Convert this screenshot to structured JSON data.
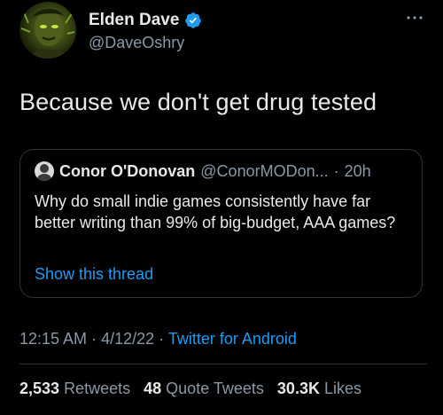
{
  "author": {
    "display_name": "Elden Dave",
    "handle": "@DaveOshry",
    "verified_color": "#1d9bf0"
  },
  "more_icon": "more-icon",
  "tweet_text": "Because we don't get drug tested",
  "quote": {
    "name": "Conor O'Donovan",
    "handle": "@ConorMODon...",
    "separator": "·",
    "time": "20h",
    "text": "Why do small indie games consistently have far better writing than 99% of big-budget, AAA games?",
    "show_thread": "Show this thread"
  },
  "meta": {
    "time": "12:15 AM",
    "dot1": "·",
    "date": "4/12/22",
    "dot2": "·",
    "source": "Twitter for Android"
  },
  "stats": {
    "retweets_count": "2,533",
    "retweets_label": "Retweets",
    "quotes_count": "48",
    "quotes_label": "Quote Tweets",
    "likes_count": "30.3K",
    "likes_label": "Likes"
  },
  "colors": {
    "background": "#000000",
    "text": "#e7e9ea",
    "secondary": "#8b98a5",
    "accent": "#1d9bf0",
    "border": "#2f3336"
  }
}
